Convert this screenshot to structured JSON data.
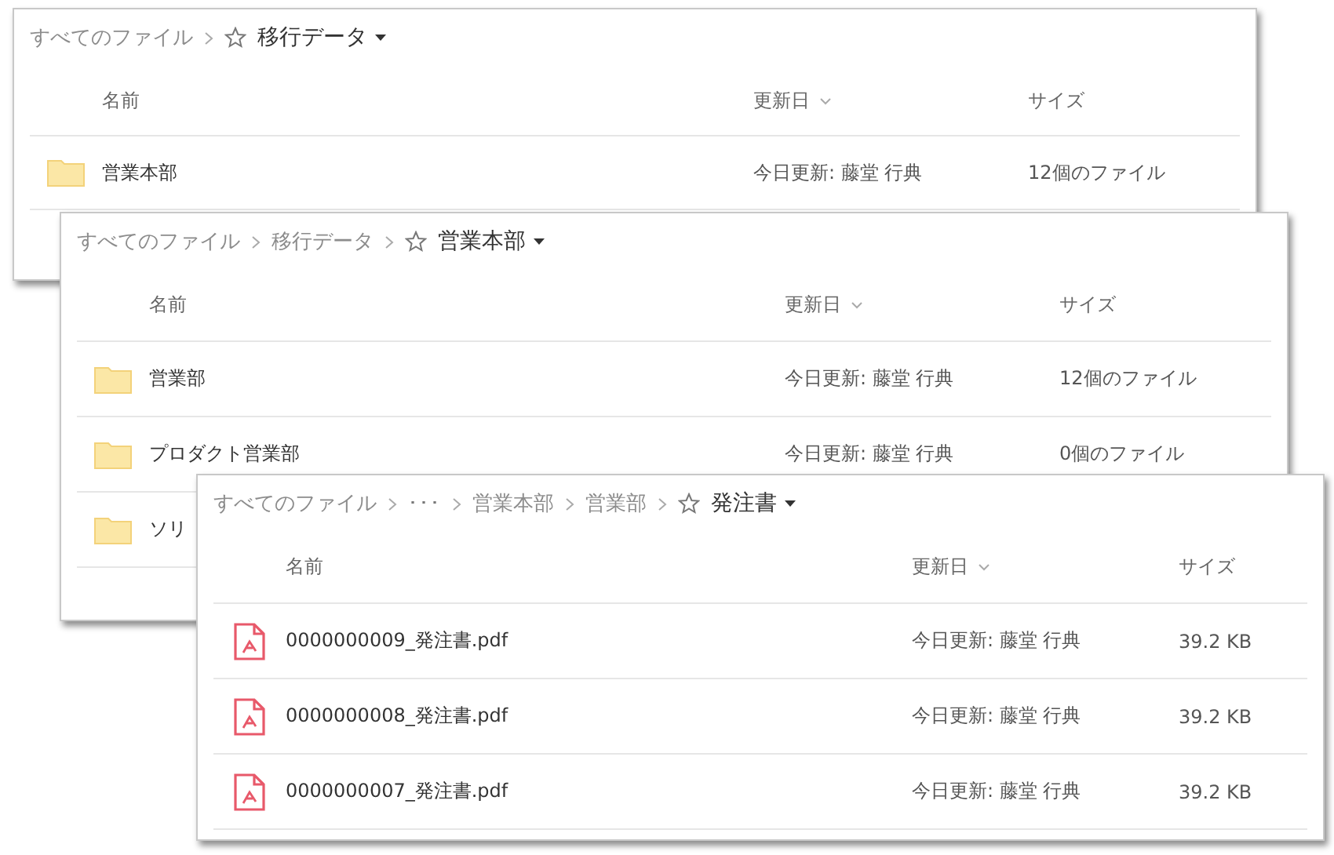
{
  "windows": [
    {
      "breadcrumb": [
        {
          "label": "すべてのファイル",
          "kind": "link"
        }
      ],
      "current": "移行データ",
      "columns": [
        "名前",
        "更新日",
        "サイズ"
      ],
      "rows": [
        {
          "kind": "folder",
          "name": "営業本部",
          "modified": "今日更新: 藤堂 行典",
          "size": "12個のファイル"
        }
      ]
    },
    {
      "breadcrumb": [
        {
          "label": "すべてのファイル",
          "kind": "link"
        },
        {
          "label": "移行データ",
          "kind": "link"
        }
      ],
      "current": "営業本部",
      "columns": [
        "名前",
        "更新日",
        "サイズ"
      ],
      "rows": [
        {
          "kind": "folder",
          "name": "営業部",
          "modified": "今日更新: 藤堂 行典",
          "size": "12個のファイル"
        },
        {
          "kind": "folder",
          "name": "プロダクト営業部",
          "modified": "今日更新: 藤堂 行典",
          "size": "0個のファイル"
        },
        {
          "kind": "folder",
          "name": "ソリ"
        }
      ]
    },
    {
      "breadcrumb": [
        {
          "label": "すべてのファイル",
          "kind": "link"
        },
        {
          "label": "･･･",
          "kind": "ellipsis"
        },
        {
          "label": "営業本部",
          "kind": "link"
        },
        {
          "label": "営業部",
          "kind": "link"
        }
      ],
      "current": "発注書",
      "columns": [
        "名前",
        "更新日",
        "サイズ"
      ],
      "rows": [
        {
          "kind": "pdf",
          "name": "0000000009_発注書.pdf",
          "modified": "今日更新: 藤堂 行典",
          "size": "39.2 KB"
        },
        {
          "kind": "pdf",
          "name": "0000000008_発注書.pdf",
          "modified": "今日更新: 藤堂 行典",
          "size": "39.2 KB"
        },
        {
          "kind": "pdf",
          "name": "0000000007_発注書.pdf",
          "modified": "今日更新: 藤堂 行典",
          "size": "39.2 KB"
        }
      ]
    }
  ]
}
